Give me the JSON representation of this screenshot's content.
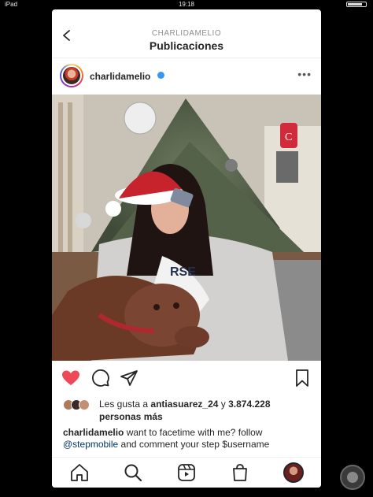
{
  "status_bar": {
    "left": "iPad ",
    "time": "19:18"
  },
  "navbar": {
    "subtitle": "CHARLIDAMELIO",
    "title": "Publicaciones"
  },
  "post": {
    "username": "charlidamelio",
    "verified": true,
    "more_label": "•••",
    "likes": {
      "prefix": "Les gusta a ",
      "user": "antiasuarez_24",
      "connector": " y ",
      "count": "3.874.228",
      "suffix": "personas más"
    },
    "caption": {
      "user": "charlidamelio",
      "text_1": " want to facetime with me? follow ",
      "mention": "@stepmobile",
      "text_2": " and comment your step $username"
    },
    "liked": true
  },
  "colors": {
    "like": "#ed4956",
    "verified": "#3897f0",
    "mention": "#00376b"
  },
  "tabs": [
    "home-icon",
    "search-icon",
    "reels-icon",
    "shop-icon",
    "profile-avatar"
  ]
}
